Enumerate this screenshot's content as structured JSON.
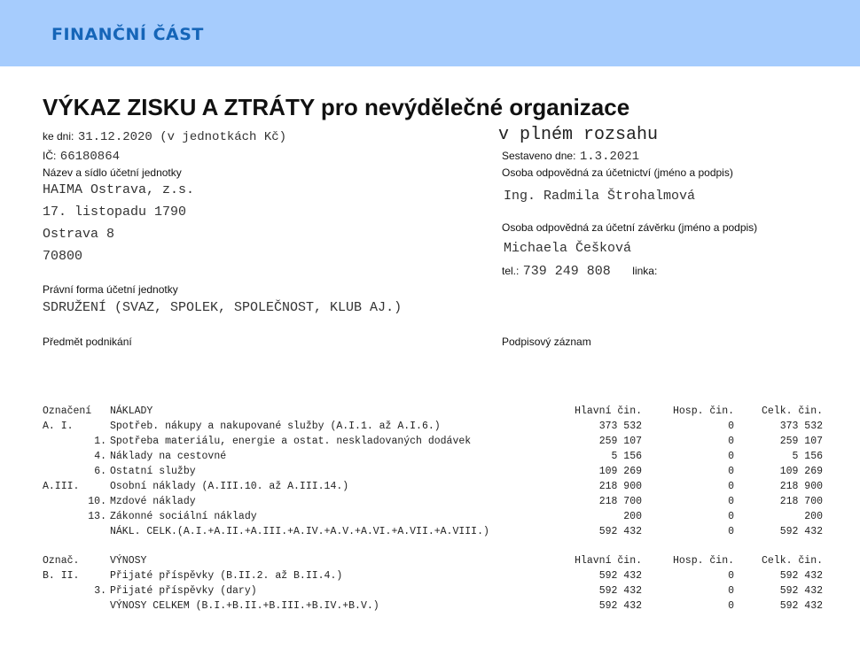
{
  "header": {
    "title": "FINANČNÍ ČÁST"
  },
  "document": {
    "title": "VÝKAZ ZISKU A ZTRÁTY pro nevýdělečné organizace",
    "date_label": "ke dni:",
    "date_value": "31.12.2020 (v jednotkách Kč)",
    "scope": "v plném rozsahu",
    "ic_label": "IČ:",
    "ic_value": "66180864",
    "compiled_label": "Sestaveno dne:",
    "compiled_value": "1.3.2021",
    "entity_label": "Název a sídlo účetní jednotky",
    "entity_lines": [
      "HAIMA Ostrava, z.s.",
      "17. listopadu 1790",
      "Ostrava 8",
      "70800"
    ],
    "accounting_person_label": "Osoba odpovědná za účetnictví (jméno a podpis)",
    "accounting_person": "Ing. Radmila Štrohalmová",
    "closing_person_label": "Osoba odpovědná za účetní závěrku (jméno a podpis)",
    "closing_person": "Michaela Češková",
    "tel_label": "tel.:",
    "tel_value": "739 249 808",
    "ext_label": "linka:",
    "legal_form_label": "Právní forma účetní jednotky",
    "legal_form_value": "SDRUŽENÍ (SVAZ, SPOLEK, SPOLEČNOST, KLUB AJ.)",
    "business_label": "Předmět podnikání",
    "signature_label": "Podpisový záznam"
  },
  "costs": {
    "header": {
      "code": "Označení",
      "name": "NÁKLADY",
      "main": "Hlavní čin.",
      "hosp": "Hosp. čin.",
      "celk": "Celk. čin."
    },
    "rows": [
      {
        "code": "A.  I.",
        "name": "Spotřeb. nákupy a nakupované služby (A.I.1. až A.I.6.)",
        "main": "373 532",
        "hosp": "0",
        "celk": "373 532",
        "indent": 0
      },
      {
        "code": "1.",
        "name": "Spotřeba materiálu, energie a ostat. neskladovaných dodávek",
        "main": "259 107",
        "hosp": "0",
        "celk": "259 107",
        "indent": 1
      },
      {
        "code": "4.",
        "name": "Náklady na cestovné",
        "main": "5 156",
        "hosp": "0",
        "celk": "5 156",
        "indent": 1
      },
      {
        "code": "6.",
        "name": "Ostatní služby",
        "main": "109 269",
        "hosp": "0",
        "celk": "109 269",
        "indent": 1
      },
      {
        "code": "A.III.",
        "name": "Osobní náklady (A.III.10. až A.III.14.)",
        "main": "218 900",
        "hosp": "0",
        "celk": "218 900",
        "indent": 0
      },
      {
        "code": "10.",
        "name": "Mzdové náklady",
        "main": "218 700",
        "hosp": "0",
        "celk": "218 700",
        "indent": 1
      },
      {
        "code": "13.",
        "name": "Zákonné sociální náklady",
        "main": "200",
        "hosp": "0",
        "celk": "200",
        "indent": 1
      },
      {
        "code": "",
        "name": "NÁKL. CELK.(A.I.+A.II.+A.III.+A.IV.+A.V.+A.VI.+A.VII.+A.VIII.)",
        "main": "592 432",
        "hosp": "0",
        "celk": "592 432",
        "indent": 0
      }
    ]
  },
  "revenues": {
    "header": {
      "code": "Označ.",
      "name": "VÝNOSY",
      "main": "Hlavní čin.",
      "hosp": "Hosp. čin.",
      "celk": "Celk. čin."
    },
    "rows": [
      {
        "code": "B. II.",
        "name": "Přijaté příspěvky (B.II.2. až B.II.4.)",
        "main": "592 432",
        "hosp": "0",
        "celk": "592 432",
        "indent": 0
      },
      {
        "code": "3.",
        "name": "Přijaté příspěvky (dary)",
        "main": "592 432",
        "hosp": "0",
        "celk": "592 432",
        "indent": 1
      },
      {
        "code": "",
        "name": "VÝNOSY CELKEM (B.I.+B.II.+B.III.+B.IV.+B.V.)",
        "main": "592 432",
        "hosp": "0",
        "celk": "592 432",
        "indent": 0
      }
    ]
  }
}
